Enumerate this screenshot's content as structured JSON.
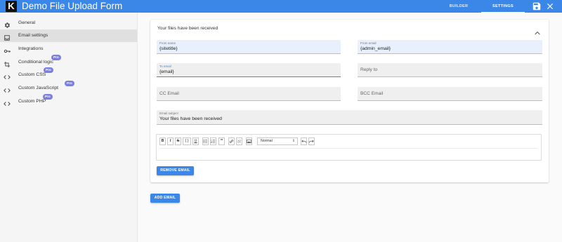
{
  "header": {
    "logo_letter": "K",
    "title": "Demo File Upload Form",
    "tabs": [
      {
        "label": "BUILDER",
        "active": false
      },
      {
        "label": "SETTINGS",
        "active": true
      }
    ],
    "icons": [
      "save-icon",
      "close-icon"
    ]
  },
  "sidebar": {
    "items": [
      {
        "label": "General",
        "icon": "gear-icon",
        "active": false,
        "pro": false
      },
      {
        "label": "Email settings",
        "icon": "inbox-icon",
        "active": true,
        "pro": false
      },
      {
        "label": "Integrations",
        "icon": "key-icon",
        "active": false,
        "pro": false
      },
      {
        "label": "Conditional logic",
        "icon": "crop-icon",
        "active": false,
        "pro": true
      },
      {
        "label": "Custom CSS",
        "icon": "code-icon",
        "active": false,
        "pro": true
      },
      {
        "label": "Custom JavaScript",
        "icon": "code-icon",
        "active": false,
        "pro": true
      },
      {
        "label": "Custom PHP",
        "icon": "code-icon",
        "active": false,
        "pro": true
      }
    ],
    "pro_label": "Pro"
  },
  "email_card": {
    "title": "Your files have been received",
    "from_name": {
      "label": "From name",
      "value": "{sitetitle}"
    },
    "from_email": {
      "label": "From email",
      "value": "{admin_email}"
    },
    "to_email": {
      "label": "To email",
      "value": "{email}"
    },
    "reply_to": {
      "placeholder": "Reply to"
    },
    "cc_email": {
      "placeholder": "CC Email"
    },
    "bcc_email": {
      "placeholder": "BCC Email"
    },
    "subject": {
      "label": "Email subject",
      "value": "Your files have been received"
    },
    "editor": {
      "buttons": [
        "B",
        "I",
        "S",
        "{ }",
        "U",
        "bulleted-list-icon",
        "numbered-list-icon",
        "\"",
        "link-icon",
        "unlink-icon",
        "image-icon"
      ],
      "format_value": "Normal",
      "history": [
        "undo-icon",
        "redo-icon"
      ]
    },
    "remove_button": "REMOVE EMAIL"
  },
  "add_button": "ADD EMAIL",
  "colors": {
    "accent": "#3a87e8",
    "pro_badge": "#7b7fe0",
    "active_item": "#e0e0e0",
    "filled_field": "#e8f0fe"
  }
}
